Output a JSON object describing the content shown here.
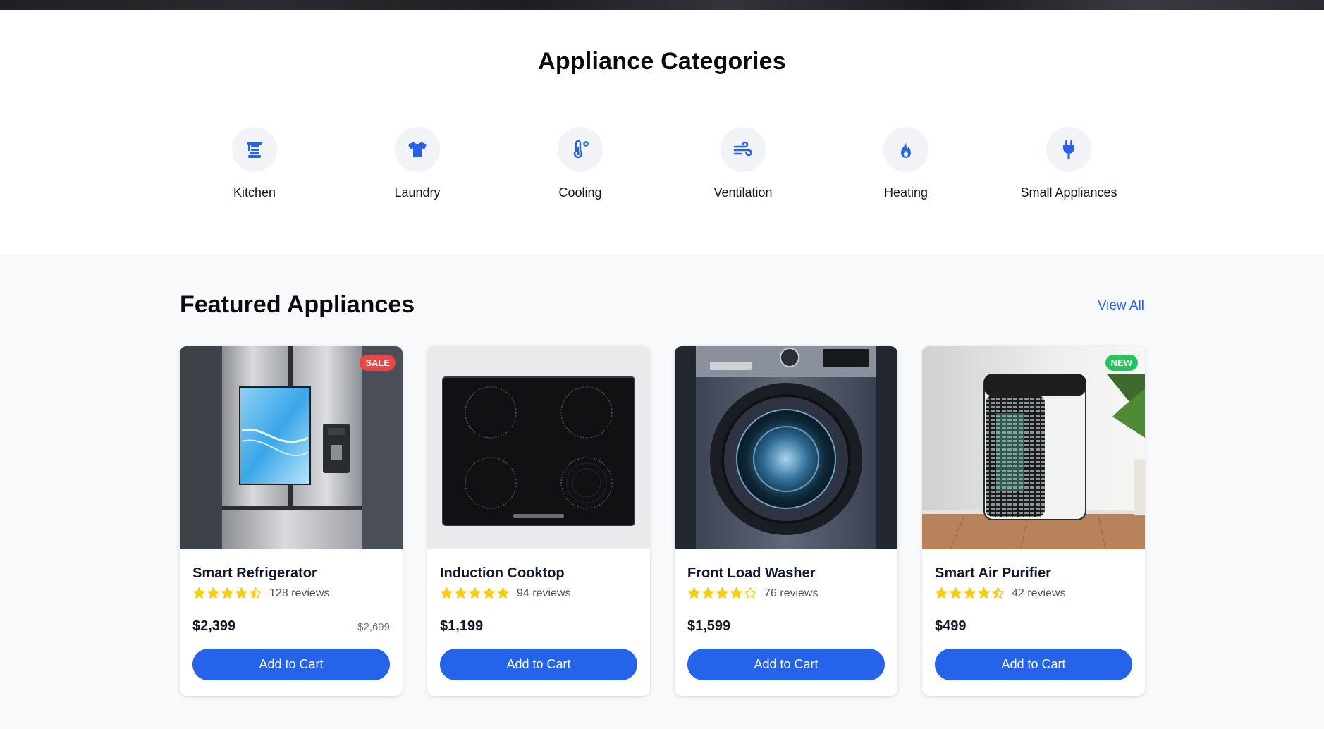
{
  "categories": {
    "title": "Appliance Categories",
    "items": [
      {
        "label": "Kitchen",
        "icon": "blender-icon"
      },
      {
        "label": "Laundry",
        "icon": "shirt-icon"
      },
      {
        "label": "Cooling",
        "icon": "thermometer-icon"
      },
      {
        "label": "Ventilation",
        "icon": "wind-icon"
      },
      {
        "label": "Heating",
        "icon": "fire-icon"
      },
      {
        "label": "Small Appliances",
        "icon": "plug-icon"
      }
    ]
  },
  "featured": {
    "title": "Featured Appliances",
    "view_all": "View All",
    "products": [
      {
        "name": "Smart Refrigerator",
        "rating": 4.5,
        "reviews": "128 reviews",
        "price": "$2,399",
        "old_price": "$2,699",
        "badge": "SALE",
        "cart_label": "Add to Cart"
      },
      {
        "name": "Induction Cooktop",
        "rating": 5,
        "reviews": "94 reviews",
        "price": "$1,199",
        "old_price": "",
        "badge": "",
        "cart_label": "Add to Cart"
      },
      {
        "name": "Front Load Washer",
        "rating": 4,
        "reviews": "76 reviews",
        "price": "$1,599",
        "old_price": "",
        "badge": "",
        "cart_label": "Add to Cart"
      },
      {
        "name": "Smart Air Purifier",
        "rating": 4.5,
        "reviews": "42 reviews",
        "price": "$499",
        "old_price": "",
        "badge": "NEW",
        "cart_label": "Add to Cart"
      }
    ]
  },
  "colors": {
    "accent": "#2563eb",
    "star": "#facc15",
    "sale": "#ef4444",
    "new": "#22c55e"
  }
}
